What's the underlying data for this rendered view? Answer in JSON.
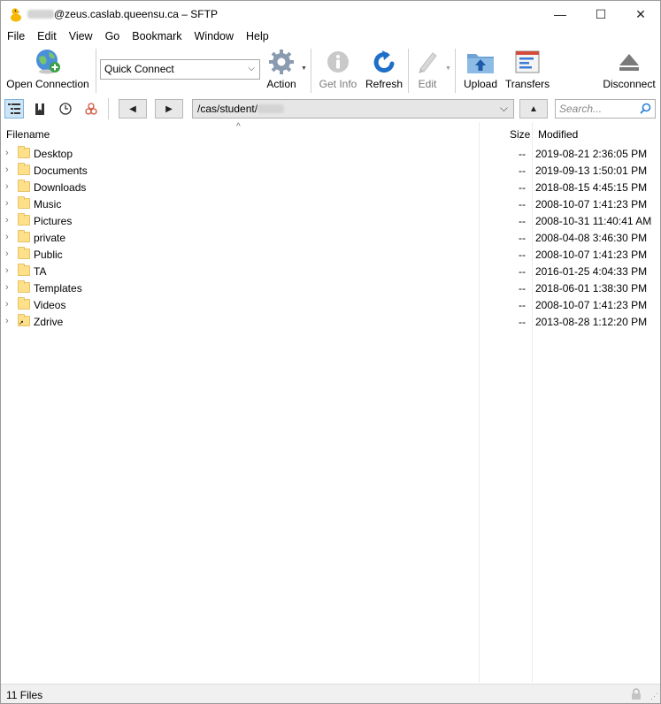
{
  "window": {
    "title_suffix": "@zeus.caslab.queensu.ca – SFTP",
    "minimize": "—",
    "maximize": "☐",
    "close": "✕"
  },
  "menu": [
    "File",
    "Edit",
    "View",
    "Go",
    "Bookmark",
    "Window",
    "Help"
  ],
  "toolbar": {
    "open_connection": "Open Connection",
    "quick_connect": "Quick Connect",
    "action": "Action",
    "get_info": "Get Info",
    "refresh": "Refresh",
    "edit": "Edit",
    "upload": "Upload",
    "transfers": "Transfers",
    "disconnect": "Disconnect"
  },
  "nav": {
    "back": "◀",
    "forward": "▶",
    "up": "▲",
    "path": "/cas/student/",
    "search_placeholder": "Search..."
  },
  "columns": {
    "filename": "Filename",
    "size": "Size",
    "modified": "Modified"
  },
  "files": [
    {
      "name": "Desktop",
      "size": "--",
      "modified": "2019-08-21 2:36:05 PM"
    },
    {
      "name": "Documents",
      "size": "--",
      "modified": "2019-09-13 1:50:01 PM"
    },
    {
      "name": "Downloads",
      "size": "--",
      "modified": "2018-08-15 4:45:15 PM"
    },
    {
      "name": "Music",
      "size": "--",
      "modified": "2008-10-07 1:41:23 PM"
    },
    {
      "name": "Pictures",
      "size": "--",
      "modified": "2008-10-31 11:40:41 AM"
    },
    {
      "name": "private",
      "size": "--",
      "modified": "2008-04-08 3:46:30 PM"
    },
    {
      "name": "Public",
      "size": "--",
      "modified": "2008-10-07 1:41:23 PM"
    },
    {
      "name": "TA",
      "size": "--",
      "modified": "2016-01-25 4:04:33 PM"
    },
    {
      "name": "Templates",
      "size": "--",
      "modified": "2018-06-01 1:38:30 PM"
    },
    {
      "name": "Videos",
      "size": "--",
      "modified": "2008-10-07 1:41:23 PM"
    },
    {
      "name": "Zdrive",
      "size": "--",
      "modified": "2013-08-28 1:12:20 PM"
    }
  ],
  "status": {
    "text": "11 Files"
  },
  "colors": {
    "accent": "#2a7fd4",
    "folder": "#ffe08a",
    "statusbar": "#f0f0f0"
  }
}
